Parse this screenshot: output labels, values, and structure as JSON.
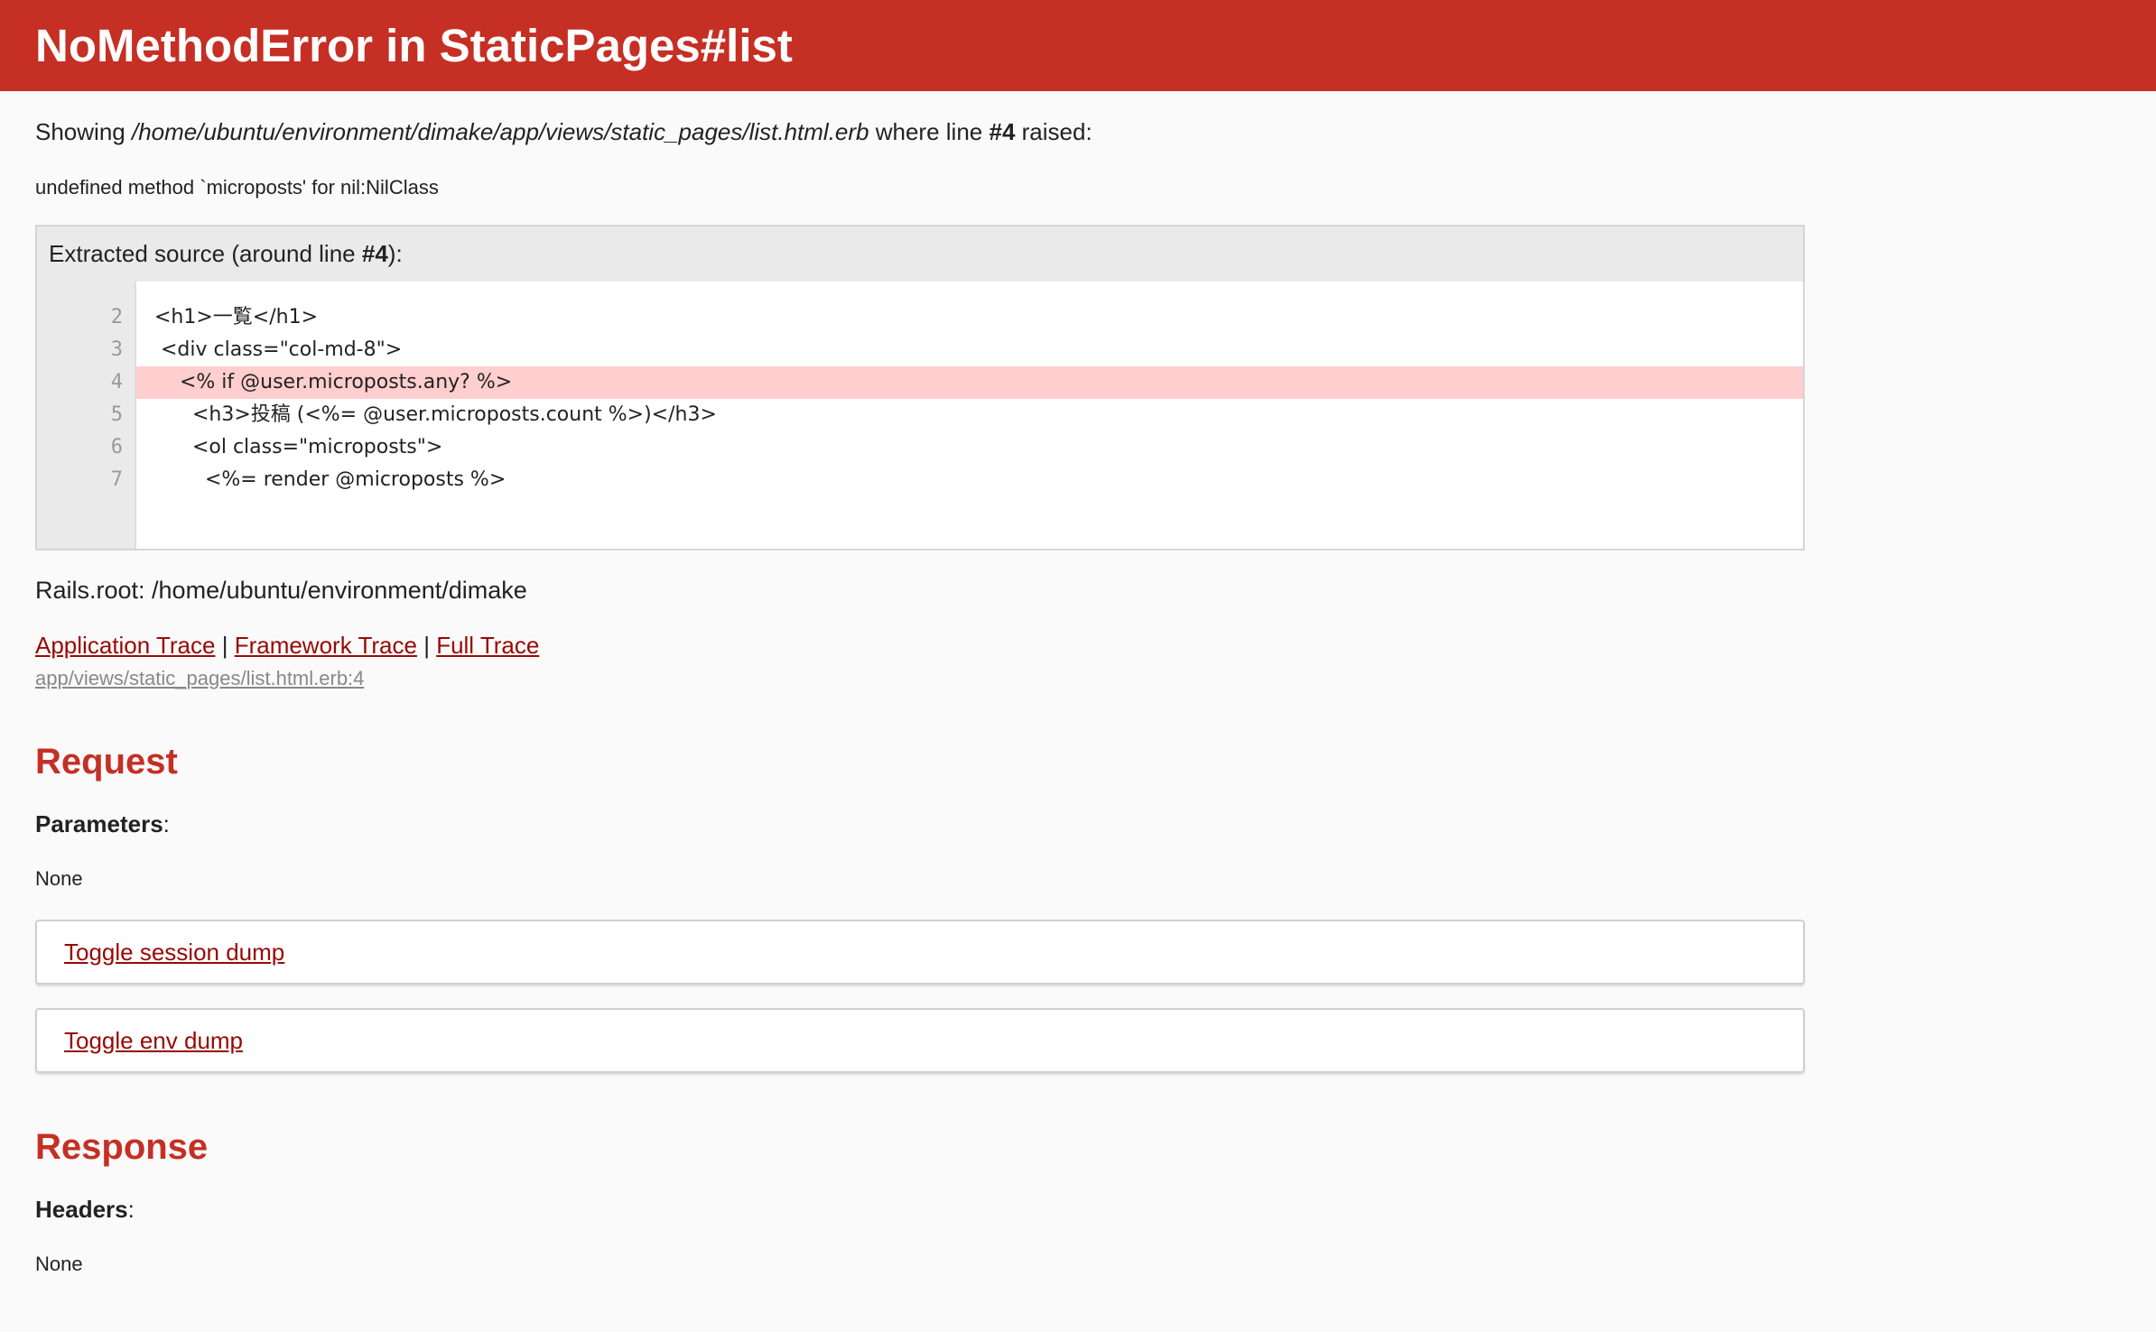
{
  "title": "NoMethodError in StaticPages#list",
  "showing": {
    "prefix": "Showing ",
    "path": "/home/ubuntu/environment/dimake/app/views/static_pages/list.html.erb",
    "middle": " where line ",
    "line": "#4",
    "suffix": " raised:"
  },
  "error_message": "undefined method `microposts' for nil:NilClass",
  "source": {
    "title_prefix": "Extracted source (around line ",
    "title_line": "#4",
    "title_suffix": "):",
    "lines": [
      {
        "num": "2",
        "code": "<h1>一覧</h1>"
      },
      {
        "num": "3",
        "code": " <div class=\"col-md-8\">"
      },
      {
        "num": "4",
        "code": "    <% if @user.microposts.any? %>"
      },
      {
        "num": "5",
        "code": "      <h3>投稿 (<%= @user.microposts.count %>)</h3>"
      },
      {
        "num": "6",
        "code": "      <ol class=\"microposts\">"
      },
      {
        "num": "7",
        "code": "        <%= render @microposts %>"
      }
    ],
    "highlight_line": "4"
  },
  "rails_root": "Rails.root: /home/ubuntu/environment/dimake",
  "traces": {
    "application": "Application Trace",
    "framework": "Framework Trace",
    "full": "Full Trace",
    "separator": "|",
    "first_entry": "app/views/static_pages/list.html.erb:4"
  },
  "request": {
    "heading": "Request",
    "parameters_label": "Parameters",
    "parameters_value": "None",
    "toggle_session": "Toggle session dump",
    "toggle_env": "Toggle env dump"
  },
  "response": {
    "heading": "Response",
    "headers_label": "Headers",
    "headers_value": "None"
  },
  "colors": {
    "header_bg": "#c52f24",
    "link": "#980905",
    "highlight": "#ffcece"
  }
}
